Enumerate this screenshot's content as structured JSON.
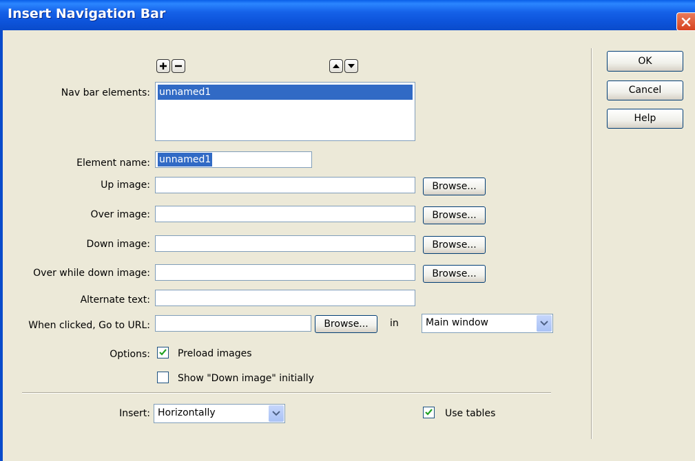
{
  "window": {
    "title": "Insert Navigation Bar"
  },
  "nav": {
    "label": "Nav bar elements:",
    "items": [
      "unnamed1"
    ]
  },
  "fields": {
    "element_name_label": "Element name:",
    "element_name_value": "unnamed1",
    "up_image_label": "Up image:",
    "over_image_label": "Over image:",
    "down_image_label": "Down image:",
    "over_while_down_label": "Over while down image:",
    "alt_text_label": "Alternate text:",
    "goto_url_label": "When clicked, Go to URL:",
    "in_label": "in",
    "target_value": "Main window",
    "options_label": "Options:",
    "preload_label": "Preload images",
    "preload_checked": true,
    "show_down_label": "Show \"Down image\" initially",
    "show_down_checked": false,
    "insert_label": "Insert:",
    "insert_value": "Horizontally",
    "use_tables_label": "Use tables",
    "use_tables_checked": true
  },
  "buttons": {
    "ok": "OK",
    "cancel": "Cancel",
    "help": "Help",
    "browse": "Browse..."
  },
  "icons": [
    "plus-icon",
    "minus-icon",
    "arrow-up-icon",
    "arrow-down-icon",
    "close-icon",
    "checkmark-icon",
    "dropdown-arrow-icon"
  ],
  "colors": {
    "titlebar": "#0a4bcb",
    "selection": "#316ac5",
    "dialog_bg": "#ece9d8"
  }
}
